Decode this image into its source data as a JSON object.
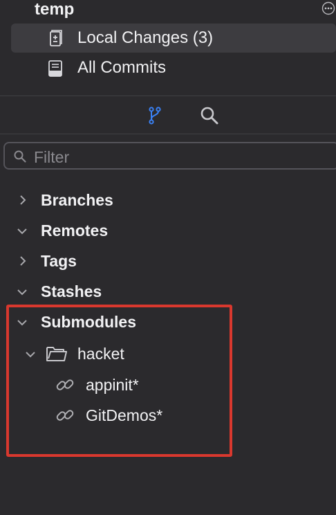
{
  "repo": {
    "title": "temp"
  },
  "nav": {
    "items": [
      {
        "label": "Local Changes (3)",
        "icon": "local-changes-icon",
        "selected": true
      },
      {
        "label": "All Commits",
        "icon": "all-commits-icon",
        "selected": false
      }
    ]
  },
  "toolbar": {
    "icons": [
      "branch-icon",
      "search-icon"
    ],
    "active_color": "#3a82f7"
  },
  "filter": {
    "placeholder": "Filter",
    "value": ""
  },
  "sidebar": {
    "sections": [
      {
        "label": "Branches",
        "expanded": false
      },
      {
        "label": "Remotes",
        "expanded": true
      },
      {
        "label": "Tags",
        "expanded": false
      },
      {
        "label": "Stashes",
        "expanded": true
      },
      {
        "label": "Submodules",
        "expanded": true
      }
    ],
    "submodules": {
      "folder": {
        "label": "hacket",
        "expanded": true
      },
      "items": [
        {
          "label": "appinit*"
        },
        {
          "label": "GitDemos*"
        }
      ]
    }
  },
  "highlight": {
    "color": "#d9382e"
  }
}
